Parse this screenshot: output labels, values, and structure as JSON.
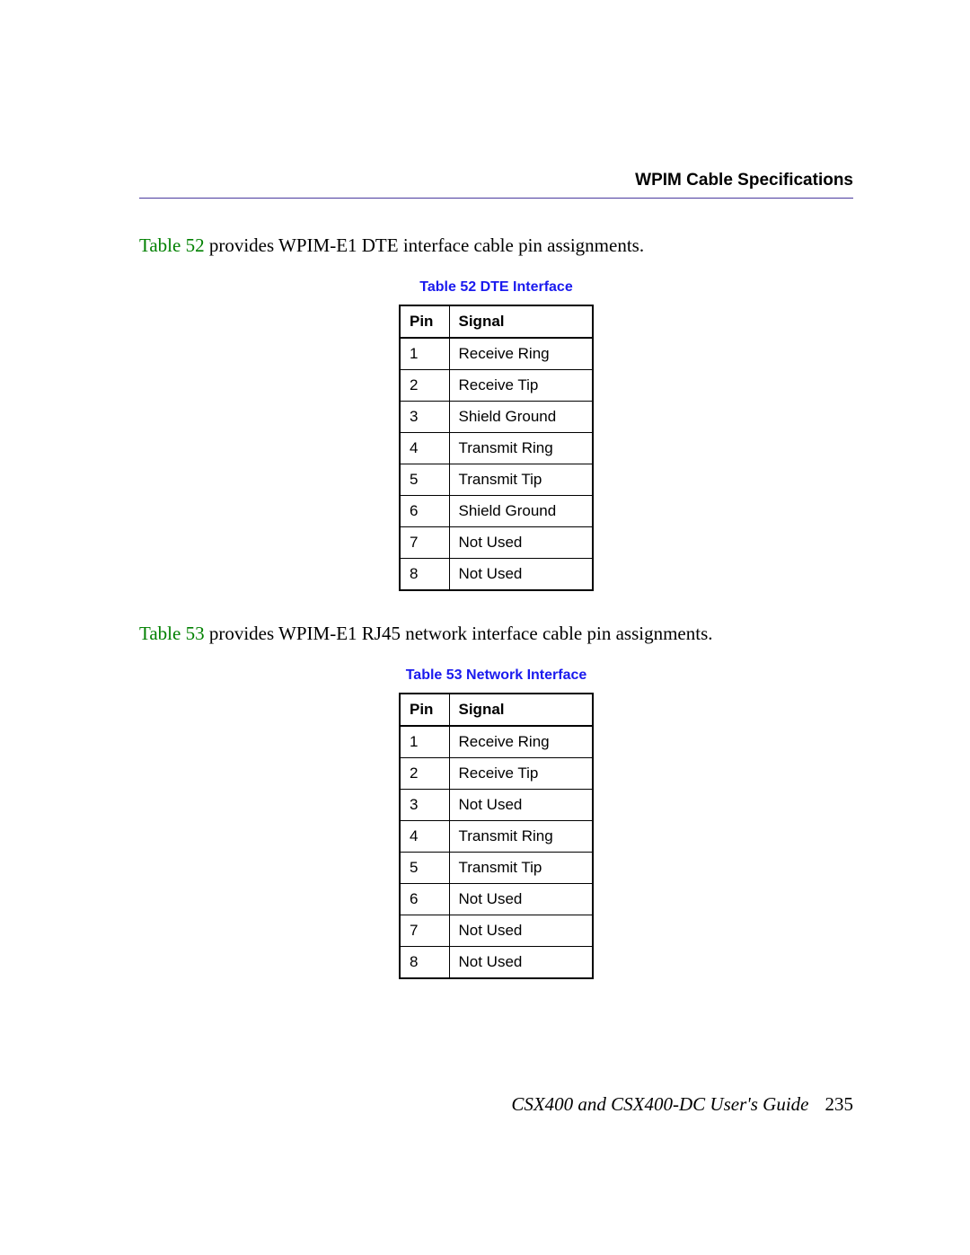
{
  "header": {
    "section_title": "WPIM Cable Specifications"
  },
  "section1": {
    "intro_ref": "Table 52",
    "intro_rest": " provides WPIM-E1 DTE interface cable pin assignments.",
    "table_caption": "Table 52  DTE Interface",
    "columns": {
      "c1": "Pin",
      "c2": "Signal"
    },
    "rows": [
      {
        "pin": "1",
        "signal": "Receive Ring"
      },
      {
        "pin": "2",
        "signal": "Receive Tip"
      },
      {
        "pin": "3",
        "signal": "Shield Ground"
      },
      {
        "pin": "4",
        "signal": "Transmit Ring"
      },
      {
        "pin": "5",
        "signal": "Transmit Tip"
      },
      {
        "pin": "6",
        "signal": "Shield Ground"
      },
      {
        "pin": "7",
        "signal": "Not Used"
      },
      {
        "pin": "8",
        "signal": "Not Used"
      }
    ]
  },
  "section2": {
    "intro_ref": "Table 53",
    "intro_rest": " provides WPIM-E1 RJ45 network interface cable pin assignments.",
    "table_caption": "Table 53  Network Interface",
    "columns": {
      "c1": "Pin",
      "c2": "Signal"
    },
    "rows": [
      {
        "pin": "1",
        "signal": "Receive Ring"
      },
      {
        "pin": "2",
        "signal": "Receive Tip"
      },
      {
        "pin": "3",
        "signal": "Not Used"
      },
      {
        "pin": "4",
        "signal": "Transmit Ring"
      },
      {
        "pin": "5",
        "signal": "Transmit Tip"
      },
      {
        "pin": "6",
        "signal": "Not Used"
      },
      {
        "pin": "7",
        "signal": "Not Used"
      },
      {
        "pin": "8",
        "signal": "Not Used"
      }
    ]
  },
  "footer": {
    "doc_title": "CSX400 and CSX400-DC User's Guide",
    "page_number": "235"
  }
}
